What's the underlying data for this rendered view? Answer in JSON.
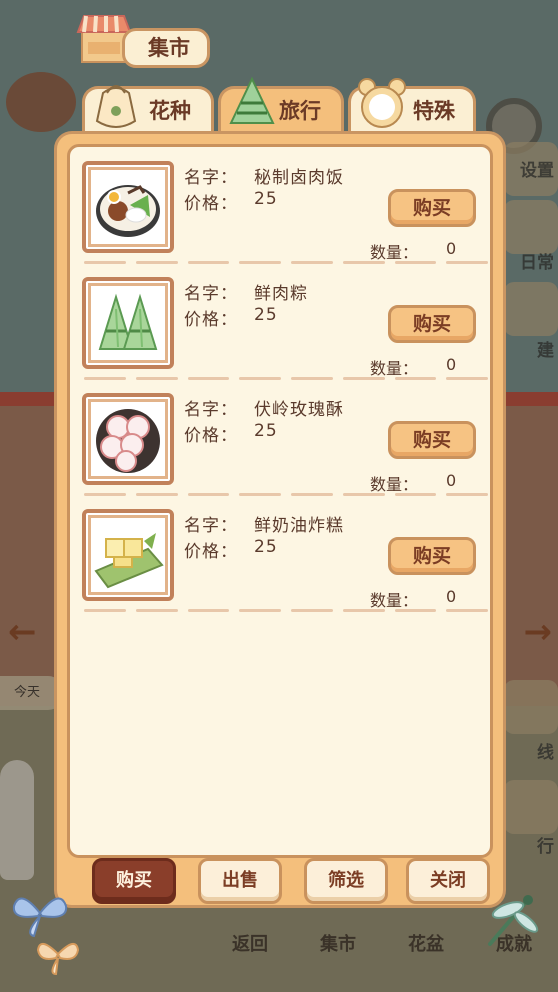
{
  "market": {
    "title": "集市"
  },
  "tabs": [
    {
      "label": "花种",
      "icon": "seed-bag-icon",
      "active": false
    },
    {
      "label": "旅行",
      "icon": "zongzi-icon",
      "active": true
    },
    {
      "label": "特殊",
      "icon": "bear-frame-icon",
      "active": false
    }
  ],
  "items": [
    {
      "name_label": "名字：",
      "name": "秘制卤肉饭",
      "price_label": "价格：",
      "price": "25",
      "buy_label": "购买",
      "qty_label": "数量：",
      "qty": "0",
      "icon": "braised-pork-rice-icon"
    },
    {
      "name_label": "名字：",
      "name": "鲜肉粽",
      "price_label": "价格：",
      "price": "25",
      "buy_label": "购买",
      "qty_label": "数量：",
      "qty": "0",
      "icon": "zongzi-icon"
    },
    {
      "name_label": "名字：",
      "name": "伏岭玫瑰酥",
      "price_label": "价格：",
      "price": "25",
      "buy_label": "购买",
      "qty_label": "数量：",
      "qty": "0",
      "icon": "rose-pastry-icon"
    },
    {
      "name_label": "名字：",
      "name": "鲜奶油炸糕",
      "price_label": "价格：",
      "price": "25",
      "buy_label": "购买",
      "qty_label": "数量：",
      "qty": "0",
      "icon": "fried-cake-icon"
    }
  ],
  "bottom_buttons": [
    {
      "label": "购买",
      "active": true
    },
    {
      "label": "出售",
      "active": false
    },
    {
      "label": "筛选",
      "active": false
    },
    {
      "label": "关闭",
      "active": false
    }
  ],
  "background": {
    "right_labels": [
      "设置",
      "日常",
      "建",
      "线",
      "行"
    ],
    "today_label": "今天",
    "bottom_labels": [
      "返回",
      "集市",
      "花盆",
      "成就"
    ]
  },
  "colors": {
    "panel": "#f4bf7c",
    "inner": "#fdf6e3",
    "border": "#c9925d",
    "active_button": "#8a3e2a",
    "text": "#5a3a2c"
  }
}
